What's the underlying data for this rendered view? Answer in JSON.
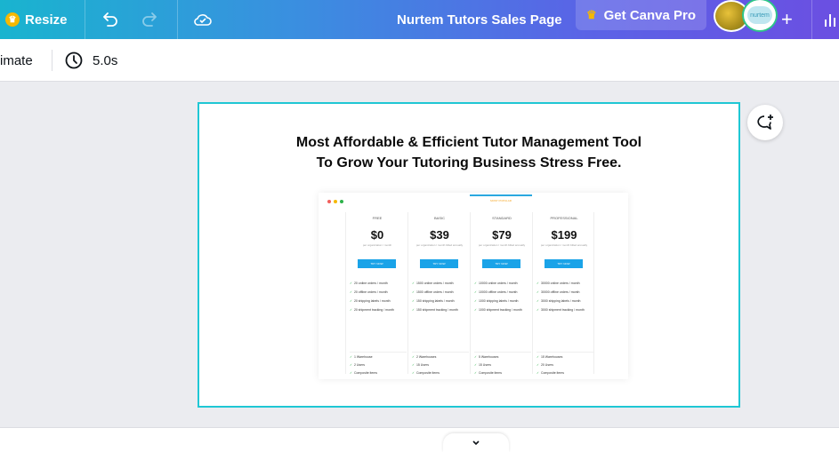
{
  "topbar": {
    "resize_label": "Resize",
    "undo_icon": "undo-icon",
    "redo_icon": "redo-icon",
    "cloud_icon": "cloud-check-icon",
    "document_title": "Nurtem Tutors Sales Page",
    "pro_button_label": "Get Canva Pro",
    "avatar_logo_text": "nurtem",
    "plus_icon": "plus-icon",
    "insights_icon": "bar-chart-icon",
    "gradient_colors": [
      "#19b4cf",
      "#3a8fe0",
      "#5a63e6",
      "#6b4fe2"
    ]
  },
  "subbar": {
    "animate_label": "imate",
    "duration_label": "5.0s",
    "clock_icon": "clock-icon"
  },
  "canvas": {
    "selection_color": "#1fc7d4",
    "headline_line1": "Most Affordable & Efficient Tutor Management Tool",
    "headline_line2": "To Grow Your Tutoring Business Stress Free.",
    "comment_icon": "add-comment-icon",
    "pricing_image": {
      "most_popular_label": "MOST POPULAR",
      "columns": [
        {
          "name": "FREE",
          "price": "$0",
          "note": "per organization / month",
          "button": "TRY NOW",
          "features": [
            "20 online orders / month",
            "20 offline orders / month",
            "20 shipping labels / month",
            "20 shipment tracking / month"
          ],
          "extras": [
            "1 Warehouse",
            "2 Users",
            "Composite items"
          ]
        },
        {
          "name": "BASIC",
          "price": "$39",
          "note": "per organization / month billed annually",
          "button": "TRY NOW",
          "features": [
            "1500 online orders / month",
            "1500 offline orders / month",
            "150 shipping labels / month",
            "150 shipment tracking / month"
          ],
          "extras": [
            "2 Warehouses",
            "15 Users",
            "Composite items"
          ]
        },
        {
          "name": "STANDARD",
          "price": "$79",
          "note": "per organization / month billed annually",
          "button": "TRY NOW",
          "features": [
            "10000 online orders / month",
            "10000 offline orders / month",
            "1000 shipping labels / month",
            "1000 shipment tracking / month"
          ],
          "extras": [
            "5 Warehouses",
            "15 Users",
            "Composite items"
          ]
        },
        {
          "name": "PROFESSIONAL",
          "price": "$199",
          "note": "per organization / month billed annually",
          "button": "TRY NOW",
          "features": [
            "30000 online orders / month",
            "30000 offline orders / month",
            "3000 shipping labels / month",
            "3000 shipment tracking / month"
          ],
          "extras": [
            "15 Warehouses",
            "20 Users",
            "Composite items"
          ]
        }
      ]
    }
  },
  "footer": {
    "expand_icon": "chevron-down-icon"
  }
}
